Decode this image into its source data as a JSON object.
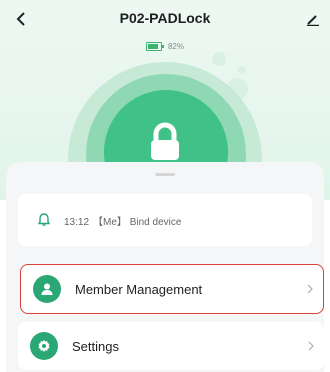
{
  "header": {
    "title": "P02-PADLock",
    "back_icon": "chevron-left-icon",
    "edit_icon": "pencil-icon"
  },
  "battery": {
    "level_text": "82%",
    "level": 82,
    "color": "#3db36f"
  },
  "notification": {
    "icon": "bell-icon",
    "time": "13:12",
    "user": "【Me】",
    "event": "Bind device"
  },
  "menu": {
    "items": [
      {
        "label": "Member Management",
        "icon": "user-icon",
        "highlighted": true
      },
      {
        "label": "Settings",
        "icon": "gear-icon",
        "highlighted": false
      }
    ]
  },
  "colors": {
    "accent": "#2aa775",
    "highlight_border": "#d9413a"
  }
}
